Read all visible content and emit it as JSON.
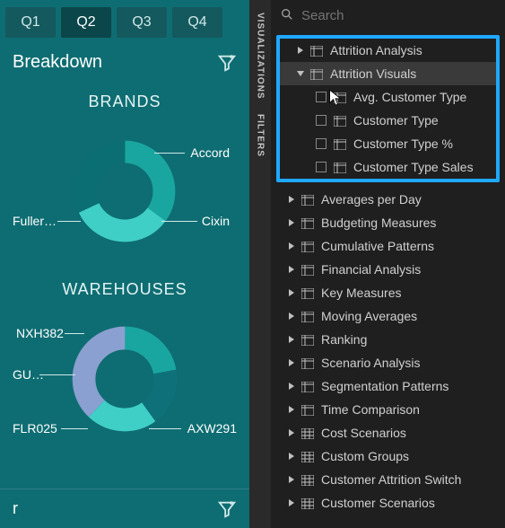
{
  "tabs": [
    "Q1",
    "Q2",
    "Q3",
    "Q4"
  ],
  "active_tab_index": 1,
  "breakdown_label": "Breakdown",
  "brands_title": "BRANDS",
  "warehouses_title": "WAREHOUSES",
  "bottom_label": "r",
  "chart_data": [
    {
      "type": "pie",
      "title": "BRANDS",
      "series": [
        {
          "name": "Accord",
          "value": 35,
          "color": "#1aa6a0"
        },
        {
          "name": "Cixin",
          "value": 33,
          "color": "#3fcfc7"
        },
        {
          "name": "Fuller…",
          "value": 32,
          "color": "#0b6e72"
        }
      ]
    },
    {
      "type": "pie",
      "title": "WAREHOUSES",
      "series": [
        {
          "name": "NXH382",
          "value": 22,
          "color": "#1aa6a0"
        },
        {
          "name": "GU…",
          "value": 18,
          "color": "#0e717a"
        },
        {
          "name": "FLR025",
          "value": 22,
          "color": "#3fcfc7"
        },
        {
          "name": "AXW291",
          "value": 38,
          "color": "#8aa0d0"
        }
      ]
    }
  ],
  "vtabs": [
    "VISUALIZATIONS",
    "FILTERS"
  ],
  "search_placeholder": "Search",
  "highlight": {
    "parent_top": {
      "label": "Attrition Analysis",
      "open": false
    },
    "parent_open": {
      "label": "Attrition Visuals",
      "open": true
    },
    "children": [
      "Avg. Customer Type",
      "Customer Type",
      "Customer Type %",
      "Customer Type Sales"
    ]
  },
  "fields": [
    "Averages per Day",
    "Budgeting Measures",
    "Cumulative Patterns",
    "Financial Analysis",
    "Key Measures",
    "Moving Averages",
    "Ranking",
    "Scenario Analysis",
    "Segmentation Patterns",
    "Time Comparison",
    "Cost Scenarios",
    "Custom Groups",
    "Customer Attrition Switch",
    "Customer Scenarios"
  ]
}
